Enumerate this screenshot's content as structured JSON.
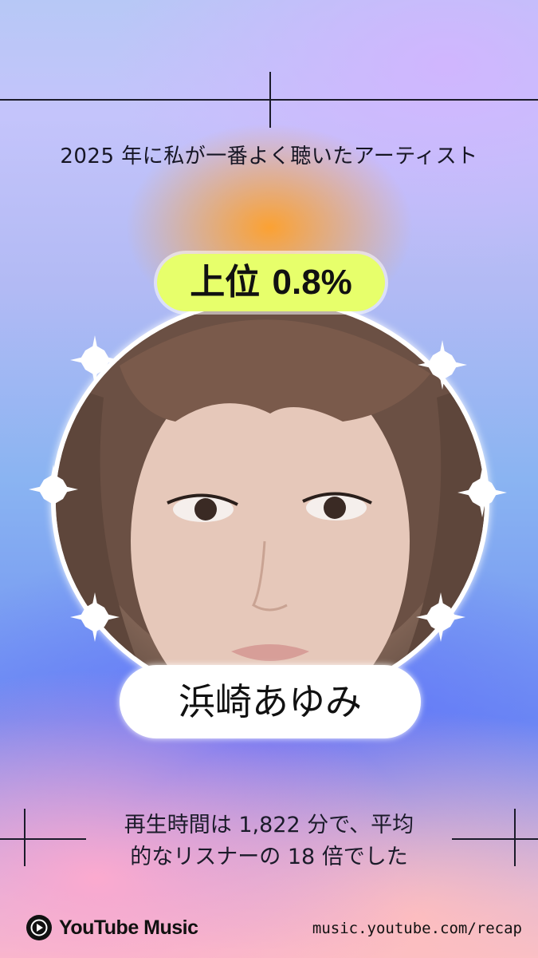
{
  "header": {
    "title": "2025 年に私が一番よく聴いたアーティスト"
  },
  "rank_badge": {
    "prefix": "上位",
    "value": "0.8%"
  },
  "artist": {
    "name": "浜崎あゆみ"
  },
  "stats": {
    "line1": "再生時間は 1,822 分で、平均",
    "line2": "的なリスナーの 18 倍でした"
  },
  "footer": {
    "brand": "YouTube Music",
    "url": "music.youtube.com/recap"
  },
  "colors": {
    "badge": "#e7ff6b",
    "text": "#161624"
  }
}
